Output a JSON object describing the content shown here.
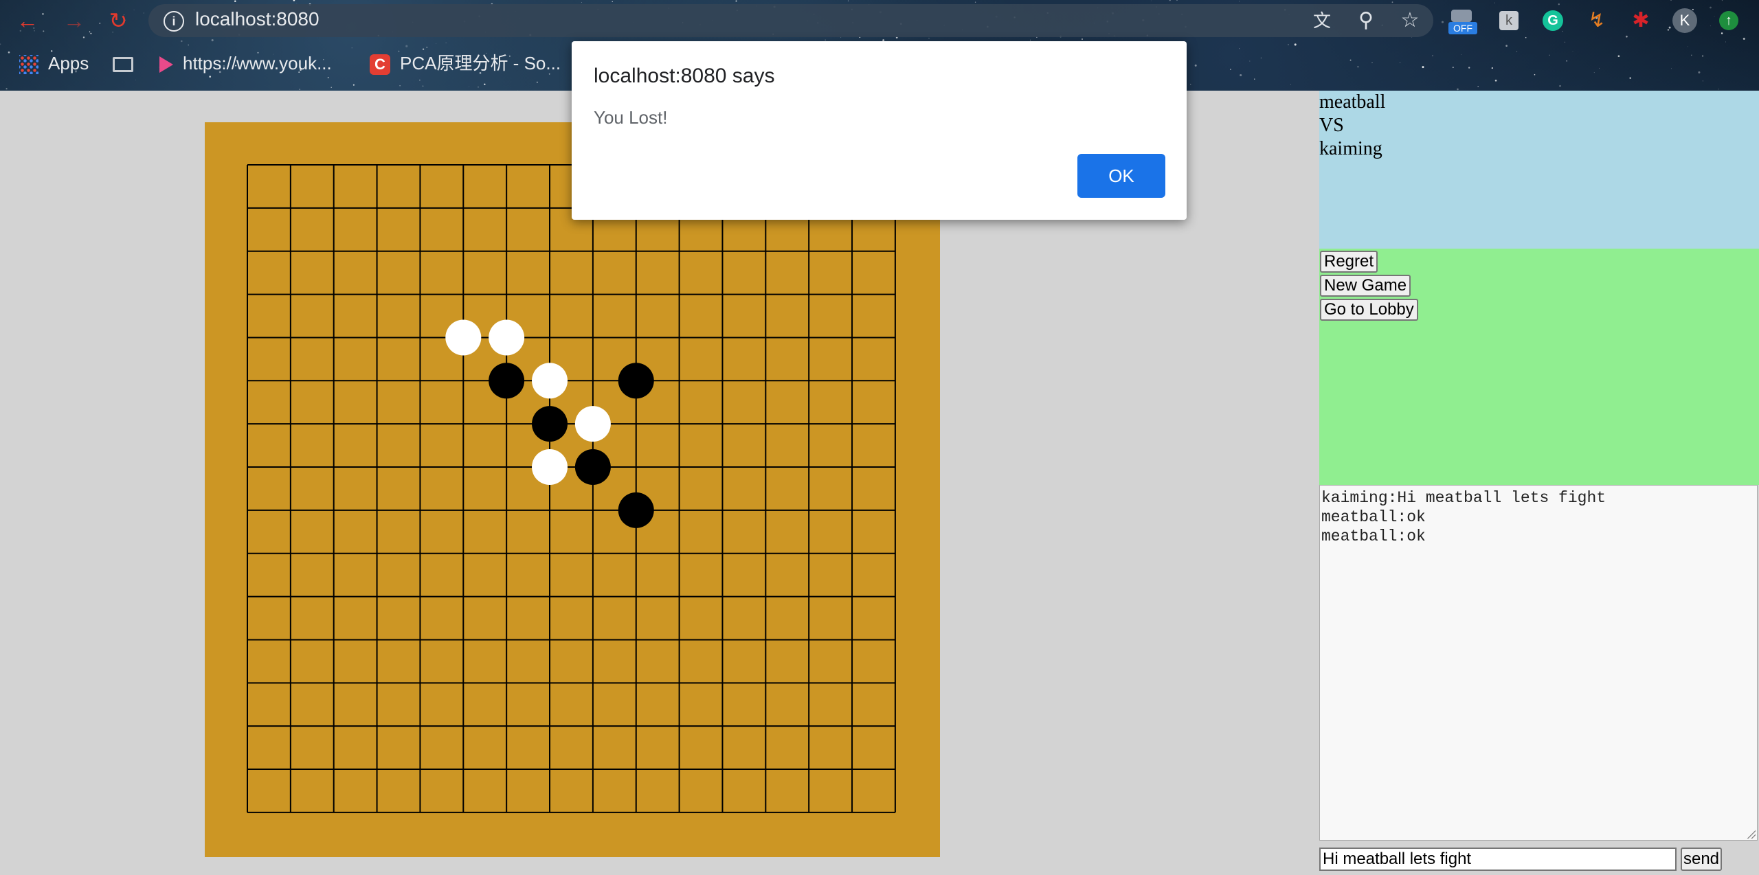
{
  "browser": {
    "url": "localhost:8080",
    "bookmarks": {
      "apps": "Apps",
      "youku": "https://www.youk...",
      "pca": "PCA原理分析 - So..."
    },
    "extensions": {
      "off_badge": "OFF",
      "profile_initial": "K"
    },
    "icons": [
      "back-icon",
      "forward-icon",
      "reload-icon",
      "info-icon",
      "translate-icon",
      "zoom-icon",
      "star-icon",
      "puzzle-icon",
      "update-icon"
    ]
  },
  "board": {
    "size": 15,
    "colors": {
      "wood": "#cc9624",
      "line": "#000000",
      "black": "#000000",
      "white": "#ffffff"
    },
    "stones": [
      {
        "col": 5,
        "row": 4,
        "color": "white"
      },
      {
        "col": 6,
        "row": 4,
        "color": "white"
      },
      {
        "col": 6,
        "row": 5,
        "color": "black"
      },
      {
        "col": 7,
        "row": 5,
        "color": "white"
      },
      {
        "col": 9,
        "row": 5,
        "color": "black"
      },
      {
        "col": 7,
        "row": 6,
        "color": "black"
      },
      {
        "col": 8,
        "row": 6,
        "color": "white"
      },
      {
        "col": 7,
        "row": 7,
        "color": "white"
      },
      {
        "col": 8,
        "row": 7,
        "color": "black"
      },
      {
        "col": 9,
        "row": 8,
        "color": "black"
      }
    ]
  },
  "players": {
    "player1": "meatball",
    "vs": "VS",
    "player2": "kaiming"
  },
  "controls": {
    "regret": "Regret",
    "new_game": "New Game",
    "lobby": "Go to Lobby"
  },
  "chat": {
    "messages": [
      "kaiming:Hi meatball lets fight",
      "meatball:ok",
      "meatball:ok"
    ],
    "input_value": "Hi meatball lets fight",
    "send_label": "send"
  },
  "dialog": {
    "title": "localhost:8080 says",
    "message": "You Lost!",
    "ok_label": "OK"
  }
}
